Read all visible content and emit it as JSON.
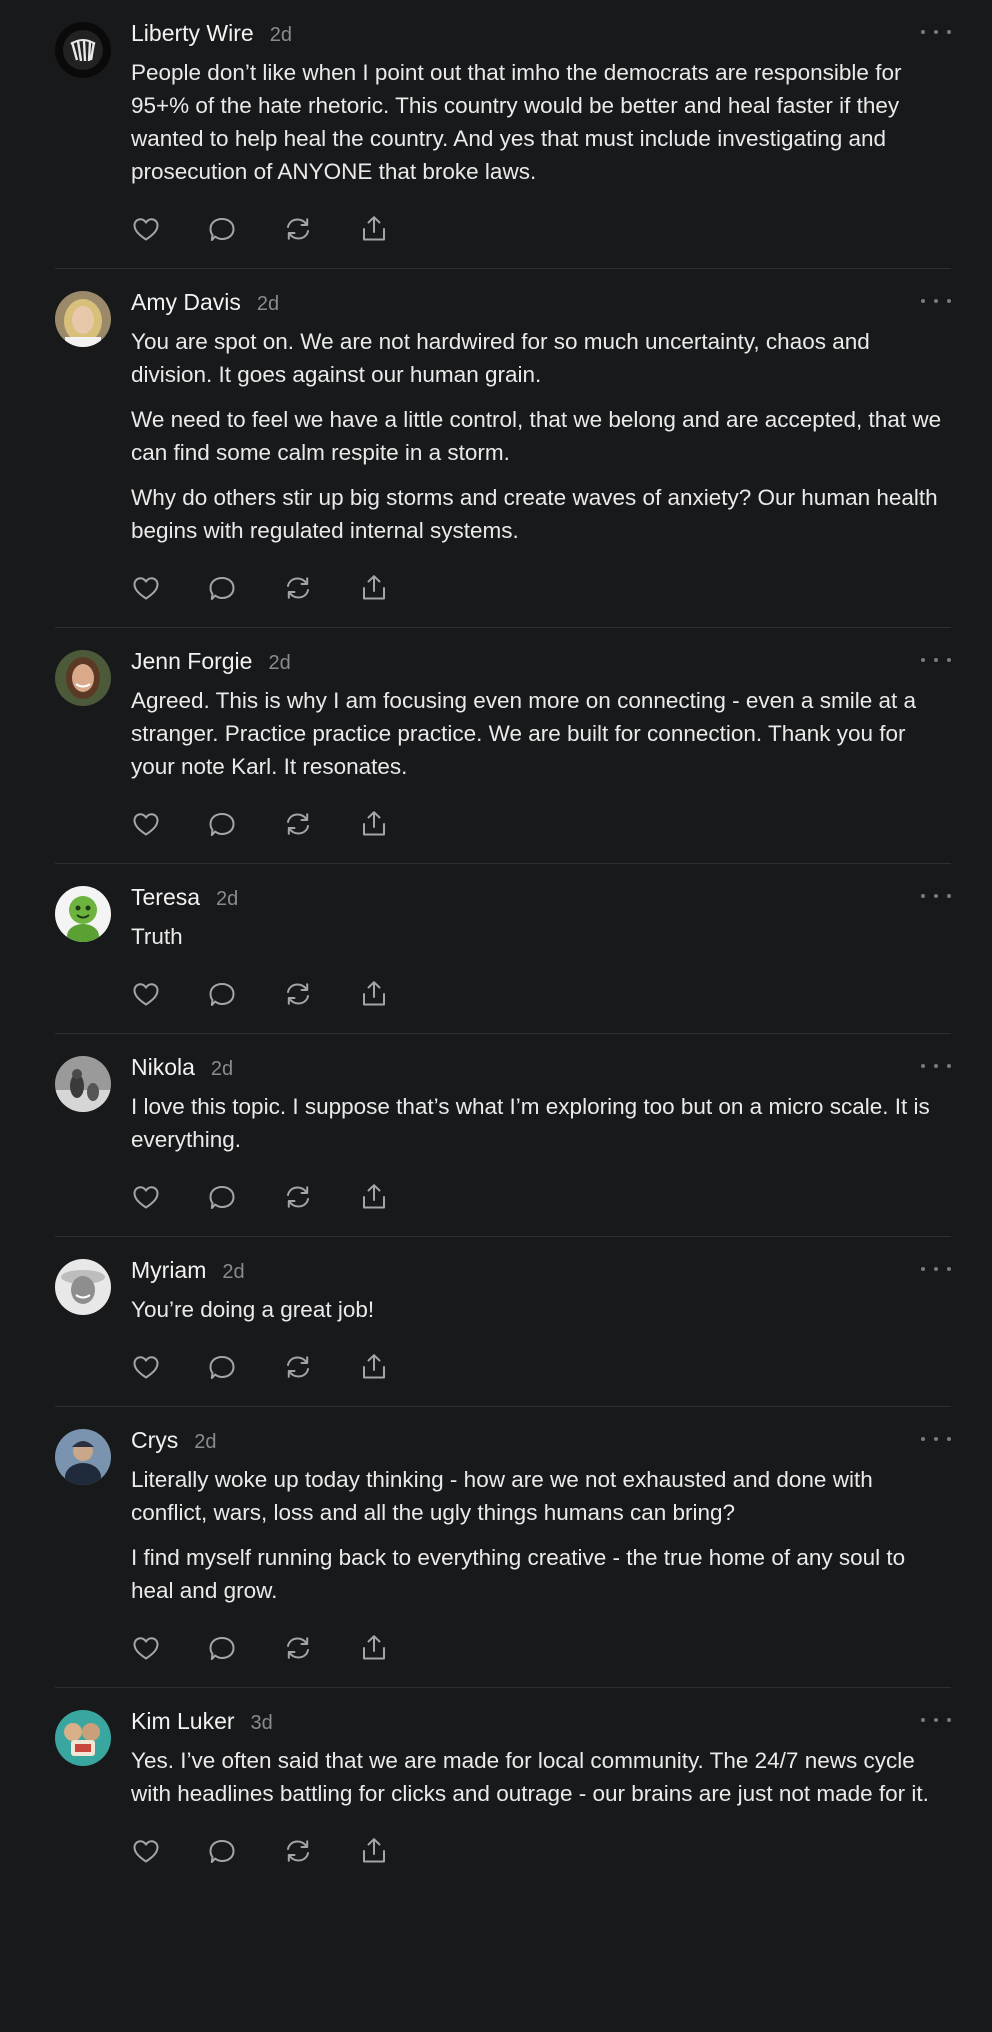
{
  "comments": [
    {
      "author": "Liberty Wire",
      "time": "2d",
      "avatar": "liberty-wire-logo",
      "paragraphs": [
        "People don’t like when I point out that imho the democrats are responsible for 95+% of the hate rhetoric. This country would be better and heal faster if they wanted to help heal the country. And yes that must include investigating and prosecution of ANYONE that broke laws."
      ]
    },
    {
      "author": "Amy Davis",
      "time": "2d",
      "avatar": "amy-davis-photo",
      "paragraphs": [
        "You are spot on. We are not hardwired for so much uncertainty, chaos and division. It goes against our human grain.",
        "We need to feel we have a little control, that we belong and are accepted, that we can find some calm respite in a storm.",
        "Why do others stir up big storms and create waves of anxiety? Our human health begins with regulated internal systems."
      ]
    },
    {
      "author": "Jenn Forgie",
      "time": "2d",
      "avatar": "jenn-forgie-photo",
      "paragraphs": [
        "Agreed. This is why I am focusing even more on connecting - even a smile at a stranger. Practice practice practice. We are built for connection. Thank you for your note Karl. It resonates."
      ]
    },
    {
      "author": "Teresa",
      "time": "2d",
      "avatar": "teresa-green-figure",
      "paragraphs": [
        "Truth"
      ]
    },
    {
      "author": "Nikola",
      "time": "2d",
      "avatar": "nikola-bw-photo",
      "paragraphs": [
        "I love this topic. I suppose that’s what I’m exploring too but on a micro scale. It is everything."
      ]
    },
    {
      "author": "Myriam",
      "time": "2d",
      "avatar": "myriam-bw-photo",
      "paragraphs": [
        "You’re doing a great job!"
      ]
    },
    {
      "author": "Crys",
      "time": "2d",
      "avatar": "crys-photo",
      "paragraphs": [
        "Literally woke up today thinking - how are we not exhausted and done with conflict, wars, loss and all the ugly things humans can bring?",
        "I find myself running back to everything creative - the true home of any soul to heal and grow."
      ]
    },
    {
      "author": "Kim Luker",
      "time": "3d",
      "avatar": "kim-luker-photo",
      "paragraphs": [
        "Yes. I’ve often said that we are made for local community. The 24/7 news cycle with headlines battling for clicks and outrage - our brains are just not made for it."
      ]
    }
  ],
  "actions": [
    "like-icon",
    "reply-icon",
    "restack-icon",
    "share-icon"
  ],
  "colors": {
    "background": "#18191b",
    "text": "#eaeaea",
    "muted": "#8a8b8f",
    "icon": "#a4a5a9",
    "divider": "#2e2f32"
  }
}
